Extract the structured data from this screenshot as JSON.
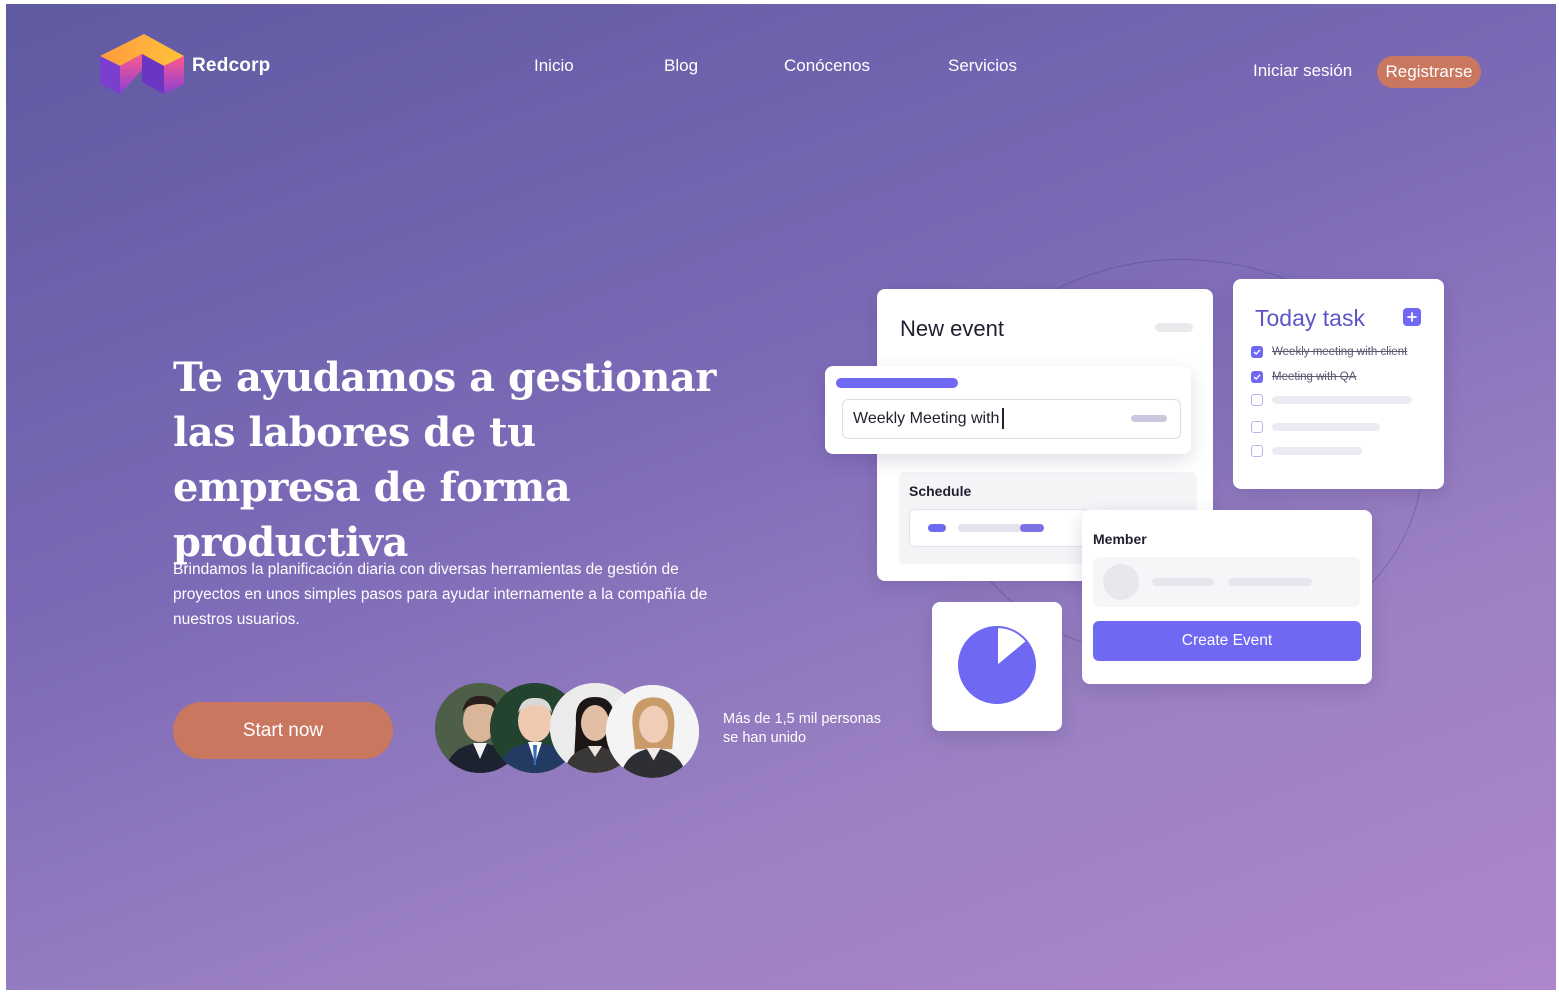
{
  "header": {
    "brand": "Redcorp",
    "nav": [
      {
        "label": "Inicio"
      },
      {
        "label": "Blog"
      },
      {
        "label": "Conócenos"
      },
      {
        "label": "Servicios"
      }
    ],
    "login_label": "Iniciar sesión",
    "register_label": "Registrarse"
  },
  "hero": {
    "title": "Te ayudamos a gestionar las labores de tu empresa de forma productiva",
    "description": "Brindamos la planificación diaria con diversas herramientas de gestión de proyectos en unos simples pasos para ayudar internamente a la compañía de nuestros usuarios.",
    "cta_label": "Start now",
    "joined_text": "Más de 1,5 mil personas se han unido"
  },
  "mockup": {
    "new_event_title": "New event",
    "event_input_value": "Weekly Meeting with",
    "schedule_label": "Schedule",
    "today_task_title": "Today task",
    "tasks": [
      {
        "text": "Weekly meeting with client",
        "done": true
      },
      {
        "text": "Meeting with QA",
        "done": true
      },
      {
        "text": "",
        "done": false
      },
      {
        "text": "",
        "done": false
      },
      {
        "text": "",
        "done": false
      }
    ],
    "member_label": "Member",
    "create_button": "Create Event",
    "pie_fraction_remaining": 0.86
  },
  "colors": {
    "accent": "#6f68f2",
    "cta": "#c9785f"
  },
  "icons": [
    "logo-cube-icon",
    "plus-icon",
    "check-icon",
    "pie-chart-icon"
  ]
}
